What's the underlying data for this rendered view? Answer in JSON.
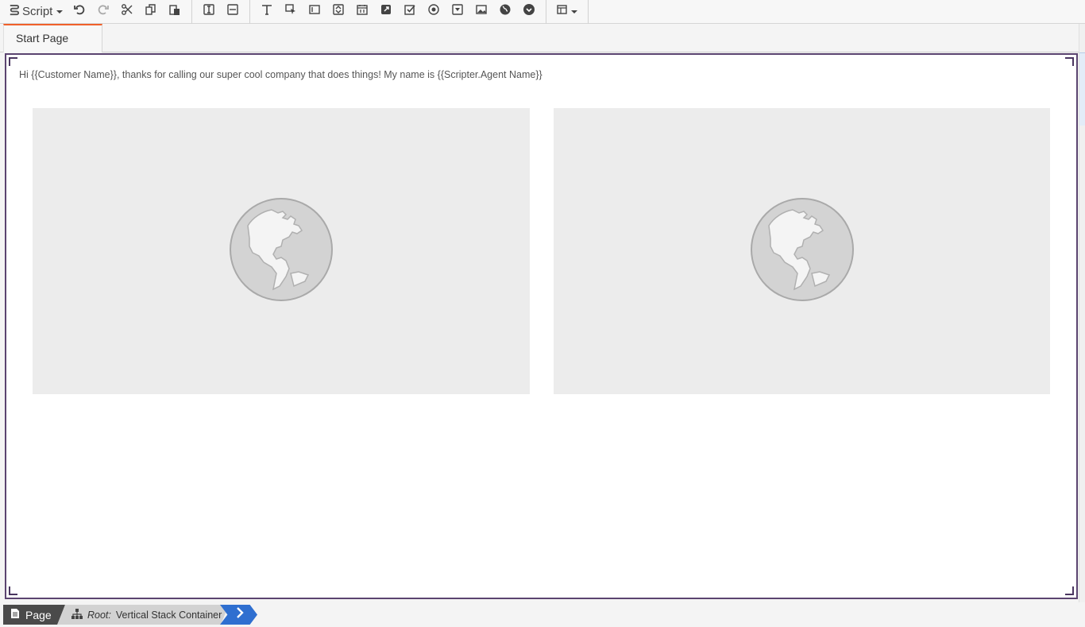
{
  "toolbar": {
    "script_menu_label": "Script",
    "actions": [
      {
        "name": "undo-icon"
      },
      {
        "name": "redo-icon"
      },
      {
        "name": "cut-icon"
      },
      {
        "name": "copy-icon"
      },
      {
        "name": "paste-icon"
      }
    ],
    "layout_tools": [
      {
        "name": "vertical-stack-icon"
      },
      {
        "name": "horizontal-stack-icon"
      }
    ],
    "widgets": [
      {
        "name": "text-icon"
      },
      {
        "name": "button-icon"
      },
      {
        "name": "textbox-icon"
      },
      {
        "name": "number-input-icon"
      },
      {
        "name": "date-picker-icon"
      },
      {
        "name": "link-icon"
      },
      {
        "name": "checkbox-icon"
      },
      {
        "name": "radio-icon"
      },
      {
        "name": "dropdown-icon"
      },
      {
        "name": "image-icon"
      },
      {
        "name": "web-page-icon"
      },
      {
        "name": "toggle-icon"
      }
    ],
    "more_menu": {
      "name": "layout-menu-icon"
    }
  },
  "tabs": [
    {
      "label": "Start Page",
      "active": true
    }
  ],
  "canvas": {
    "greeting_text": "Hi {{Customer Name}}, thanks for calling our super cool company that does things! My name is {{Scripter.Agent Name}}",
    "images": [
      {
        "icon": "globe-icon"
      },
      {
        "icon": "globe-icon"
      }
    ]
  },
  "breadcrumb": {
    "page_label": "Page",
    "root_prefix": "Root:",
    "root_label": "Vertical Stack Container"
  },
  "colors": {
    "accent_tab": "#f0602a",
    "canvas_border": "#5b4470",
    "breadcrumb_next": "#2f6fd0",
    "breadcrumb_page": "#4a4a4a"
  }
}
